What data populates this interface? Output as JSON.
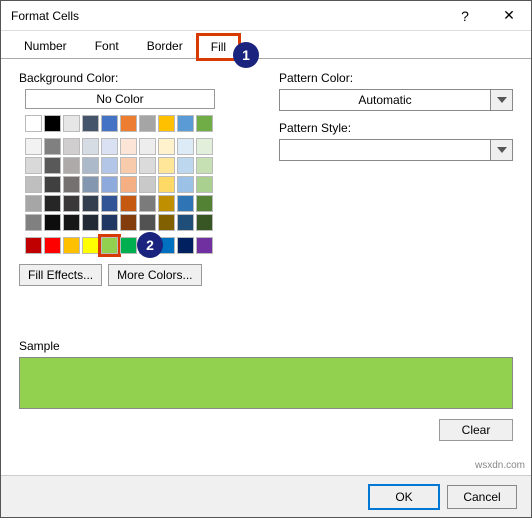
{
  "titlebar": {
    "title": "Format Cells",
    "help": "?",
    "close": "✕"
  },
  "tabs": {
    "number": "Number",
    "font": "Font",
    "border": "Border",
    "fill": "Fill"
  },
  "fill": {
    "bg_label": "Background Color:",
    "no_color": "No Color",
    "fill_effects": "Fill Effects...",
    "more_colors": "More Colors...",
    "pattern_color": "Pattern Color:",
    "pattern_color_value": "Automatic",
    "pattern_style": "Pattern Style:",
    "pattern_style_value": ""
  },
  "sample": {
    "label": "Sample",
    "clear": "Clear"
  },
  "footer": {
    "ok": "OK",
    "cancel": "Cancel"
  },
  "annotations": {
    "step1": "1",
    "step2": "2"
  },
  "watermark": "wsxdn.com",
  "colors": {
    "selected": "#92D050",
    "theme_row1": [
      "#FFFFFF",
      "#000000",
      "#E7E6E6",
      "#44546A",
      "#4472C4",
      "#ED7D31",
      "#A5A5A5",
      "#FFC000",
      "#5B9BD5",
      "#70AD47"
    ],
    "shades": [
      [
        "#F2F2F2",
        "#808080",
        "#D0CECE",
        "#D6DCE4",
        "#D9E1F2",
        "#FCE4D6",
        "#EDEDED",
        "#FFF2CC",
        "#DDEBF7",
        "#E2EFDA"
      ],
      [
        "#D9D9D9",
        "#595959",
        "#AEAAAA",
        "#ACB9CA",
        "#B4C6E7",
        "#F8CBAD",
        "#DBDBDB",
        "#FFE699",
        "#BDD7EE",
        "#C6E0B4"
      ],
      [
        "#BFBFBF",
        "#404040",
        "#757171",
        "#8497B0",
        "#8EA9DB",
        "#F4B084",
        "#C9C9C9",
        "#FFD966",
        "#9BC2E6",
        "#A9D08E"
      ],
      [
        "#A6A6A6",
        "#262626",
        "#3A3838",
        "#333F4F",
        "#305496",
        "#C65911",
        "#7B7B7B",
        "#BF8F00",
        "#2F75B5",
        "#548235"
      ],
      [
        "#808080",
        "#0D0D0D",
        "#161616",
        "#222B35",
        "#203764",
        "#833C0C",
        "#525252",
        "#806000",
        "#1F4E78",
        "#375623"
      ]
    ],
    "recent": [
      "#C00000",
      "#FF0000",
      "#FFC000",
      "#FFFF00",
      "#92D050",
      "#00B050",
      "#00B0F0",
      "#0070C0",
      "#002060",
      "#7030A0"
    ]
  }
}
